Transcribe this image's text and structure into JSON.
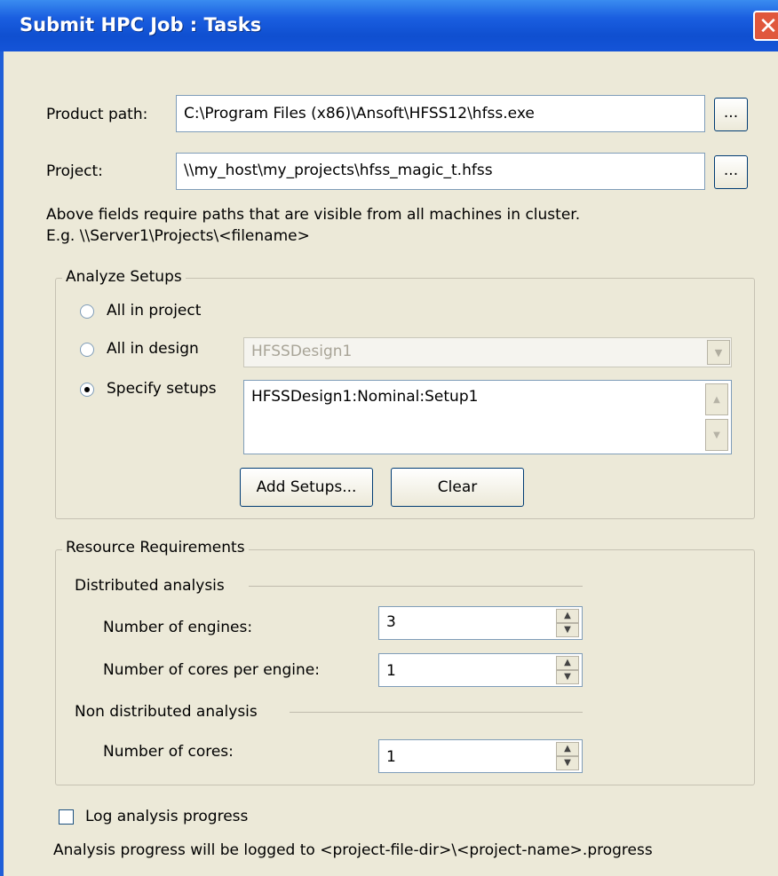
{
  "window": {
    "title": "Submit HPC Job : Tasks",
    "close_glyph": "✕"
  },
  "product_path": {
    "label": "Product path:",
    "value": "C:\\Program Files (x86)\\Ansoft\\HFSS12\\hfss.exe",
    "browse_label": "..."
  },
  "project": {
    "label": "Project:",
    "value": "\\\\my_host\\my_projects\\hfss_magic_t.hfss",
    "browse_label": "..."
  },
  "path_note": {
    "line1": "Above fields require paths that are visible from all machines in cluster.",
    "line2": "E.g. \\\\Server1\\Projects\\<filename>"
  },
  "analyze_setups": {
    "legend": "Analyze Setups",
    "all_in_project": "All in project",
    "all_in_design": "All in design",
    "design_select_value": "HFSSDesign1",
    "specify_setups": "Specify setups",
    "selected_option": "specify_setups",
    "setups_list": [
      "HFSSDesign1:Nominal:Setup1"
    ],
    "add_setups_label": "Add Setups...",
    "clear_label": "Clear"
  },
  "resources": {
    "legend": "Resource Requirements",
    "distributed_heading": "Distributed analysis",
    "engines_label": "Number of engines:",
    "engines_value": "3",
    "cores_per_engine_label": "Number of cores per engine:",
    "cores_per_engine_value": "1",
    "non_distributed_heading": "Non distributed analysis",
    "cores_label": "Number of cores:",
    "cores_value": "1"
  },
  "log": {
    "checkbox_label": "Log analysis progress",
    "checked": false,
    "note": "Analysis progress will be logged to <project-file-dir>\\<project-name>.progress"
  },
  "icons": {
    "up": "▲",
    "down": "▼",
    "dropdown": "▼"
  },
  "colors": {
    "titlebar": "#1a5ee0",
    "dialog_bg": "#ece9d8",
    "close": "#e0573c"
  }
}
